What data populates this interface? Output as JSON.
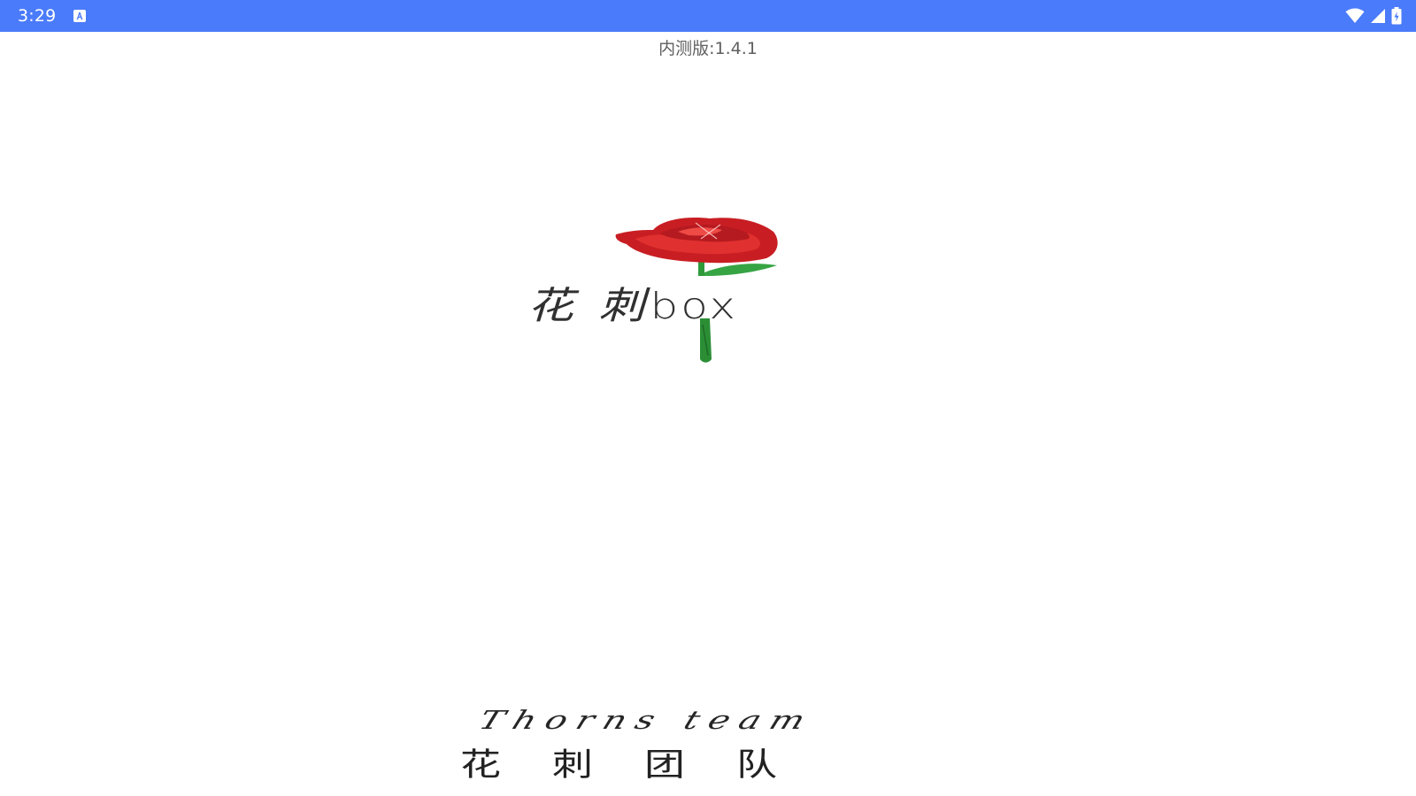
{
  "status_bar": {
    "time": "3:29",
    "notification_icon": "keyboard-a-icon",
    "icons": [
      "wifi-icon",
      "cell-signal-icon",
      "battery-charging-icon"
    ]
  },
  "version": "内测版:1.4.1",
  "logo": {
    "cn": "花 刺",
    "en": "box",
    "icon": "rose-icon"
  },
  "team": {
    "en": "Thorns team",
    "cn": "花刺团队"
  },
  "colors": {
    "status_bar": "#4a7bfa",
    "background": "#ffffff",
    "rose": "#d8262a",
    "stem": "#2f9a3a"
  }
}
